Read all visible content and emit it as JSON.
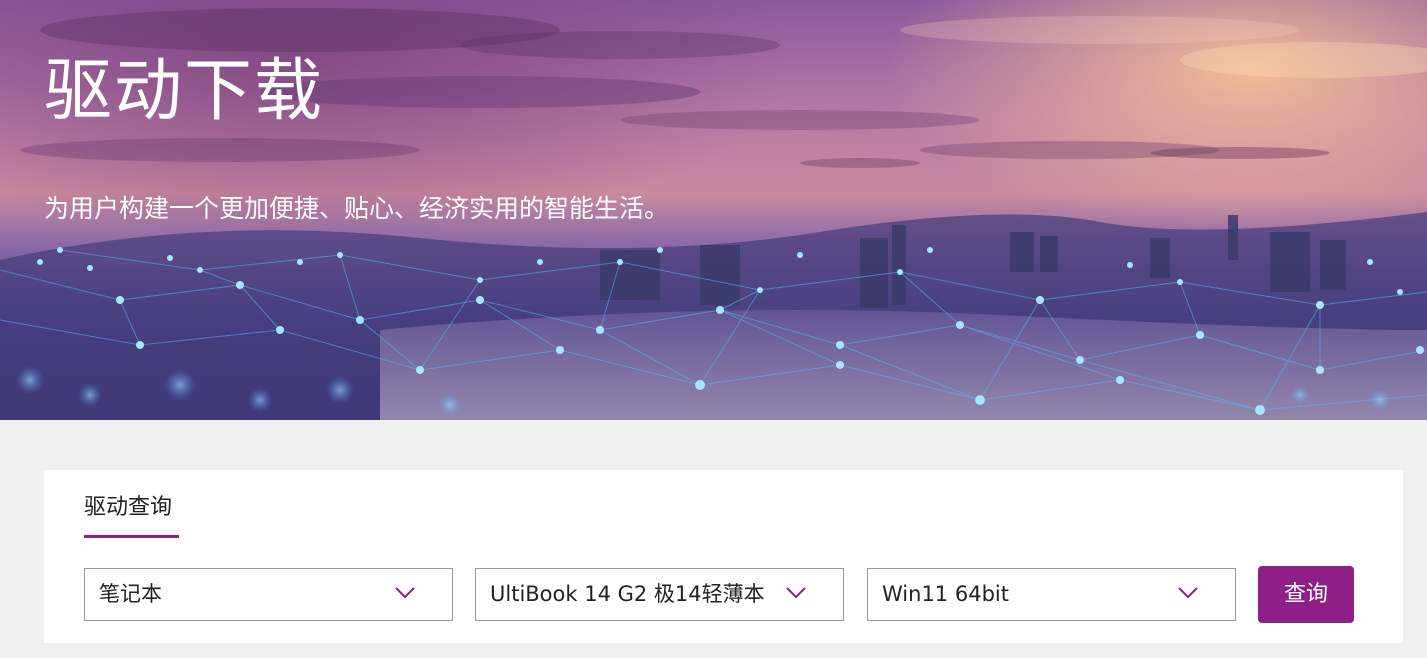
{
  "hero": {
    "title": "驱动下载",
    "subtitle": "为用户构建一个更加便捷、贴心、经济实用的智能生活。"
  },
  "query": {
    "tab_label": "驱动查询",
    "category_select": {
      "value": "笔记本"
    },
    "model_select": {
      "value": "UltiBook 14 G2 极14轻薄本"
    },
    "os_select": {
      "value": "Win11 64bit"
    },
    "search_button_label": "查询"
  },
  "colors": {
    "accent": "#8e1f87",
    "panel_background": "#ffffff",
    "page_background": "#f0f0f0"
  },
  "icons": {
    "select_arrow": "chevron-down-icon"
  }
}
